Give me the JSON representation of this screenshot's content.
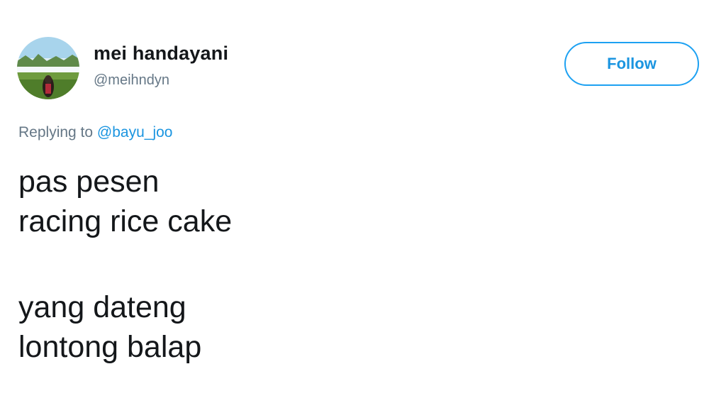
{
  "user": {
    "display_name": "mei handayani",
    "handle": "@meihndyn"
  },
  "follow_button": {
    "label": "Follow"
  },
  "reply_context": {
    "prefix": "Replying to",
    "mention": "@bayu_joo"
  },
  "tweet": {
    "lines_first": [
      "pas pesen",
      "racing rice cake"
    ],
    "lines_second": [
      "yang dateng",
      "lontong balap"
    ]
  },
  "colors": {
    "accent": "#1da1f2",
    "link": "#1b95e0",
    "secondary_text": "#657786",
    "primary_text": "#14171a"
  }
}
